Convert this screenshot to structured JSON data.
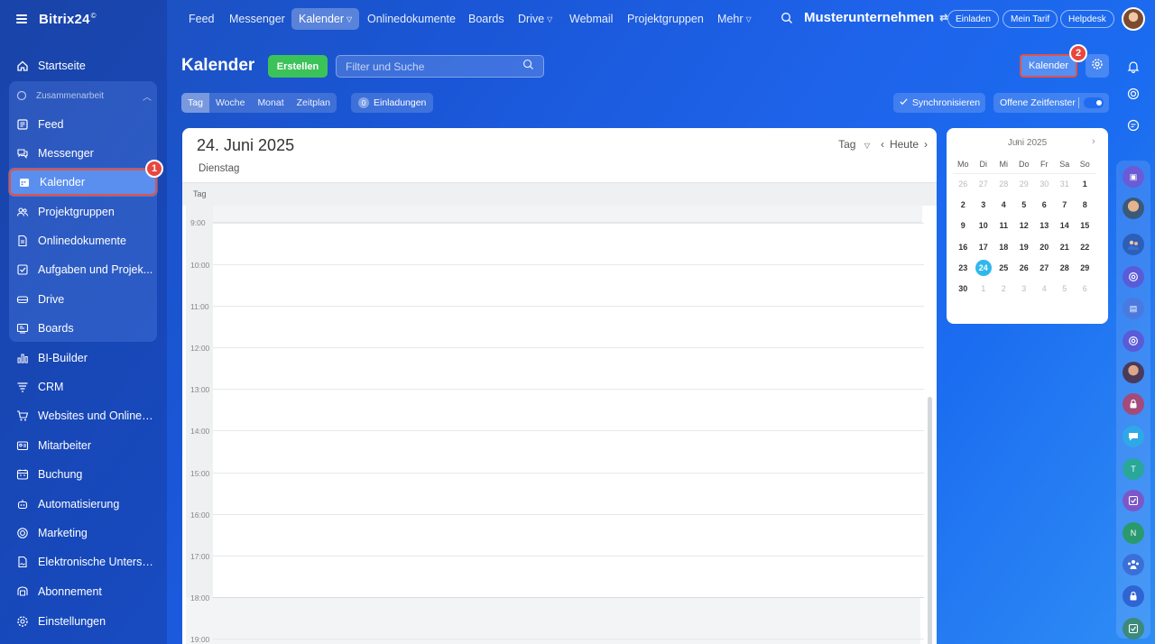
{
  "brand": {
    "name": "Bitrix24",
    "mark": "©"
  },
  "topnav": {
    "tabs": [
      "Feed",
      "Messenger",
      "Kalender",
      "Onlinedokumente",
      "Boards",
      "Drive",
      "Webmail",
      "Projektgruppen",
      "Mehr"
    ],
    "company": "Musterunternehmen",
    "invite": "Einladen",
    "tariff": "Mein Tarif",
    "helpdesk": "Helpdesk"
  },
  "sidebar": {
    "start": "Startseite",
    "group_label": "Zusammenarbeit",
    "group_items": [
      "Feed",
      "Messenger",
      "Kalender",
      "Projektgruppen",
      "Onlinedokumente",
      "Aufgaben und Projek...",
      "Drive",
      "Boards"
    ],
    "items": [
      "BI-Builder",
      "CRM",
      "Websites und Onlines...",
      "Mitarbeiter",
      "Buchung",
      "Automatisierung",
      "Marketing",
      "Elektronische Untersc...",
      "Abonnement",
      "Einstellungen"
    ]
  },
  "badges": {
    "one": "1",
    "two": "2"
  },
  "header": {
    "title": "Kalender",
    "create": "Erstellen",
    "search_placeholder": "Filter und Suche",
    "calendars_button": "Kalender"
  },
  "views": {
    "tabs": [
      "Tag",
      "Woche",
      "Monat",
      "Zeitplan"
    ],
    "invites_count": "0",
    "invites": "Einladungen",
    "sync": "Synchronisieren",
    "open_slots": "Offene Zeitfenster"
  },
  "calendar": {
    "date": "24. Juni 2025",
    "weekday": "Dienstag",
    "mode": "Tag",
    "today": "Heute",
    "strip_label": "Tag",
    "hours": [
      "9:00",
      "10:00",
      "11:00",
      "12:00",
      "13:00",
      "14:00",
      "15:00",
      "16:00",
      "17:00",
      "18:00",
      "19:00"
    ]
  },
  "mini_calendar": {
    "month": "Juni 2025",
    "weekdays": [
      "Mo",
      "Di",
      "Mi",
      "Do",
      "Fr",
      "Sa",
      "So"
    ],
    "weeks": [
      [
        "26",
        "27",
        "28",
        "29",
        "30",
        "31",
        "1"
      ],
      [
        "2",
        "3",
        "4",
        "5",
        "6",
        "7",
        "8"
      ],
      [
        "9",
        "10",
        "11",
        "12",
        "13",
        "14",
        "15"
      ],
      [
        "16",
        "17",
        "18",
        "19",
        "20",
        "21",
        "22"
      ],
      [
        "23",
        "24",
        "25",
        "26",
        "27",
        "28",
        "29"
      ],
      [
        "30",
        "1",
        "2",
        "3",
        "4",
        "5",
        "6"
      ]
    ],
    "today": "24"
  },
  "rail": {
    "t_letter": "T",
    "n_letter": "N"
  },
  "colors": {
    "accent_green": "#3bc35a",
    "highlight_red": "#e35245",
    "today_blue": "#2fb8ec"
  }
}
